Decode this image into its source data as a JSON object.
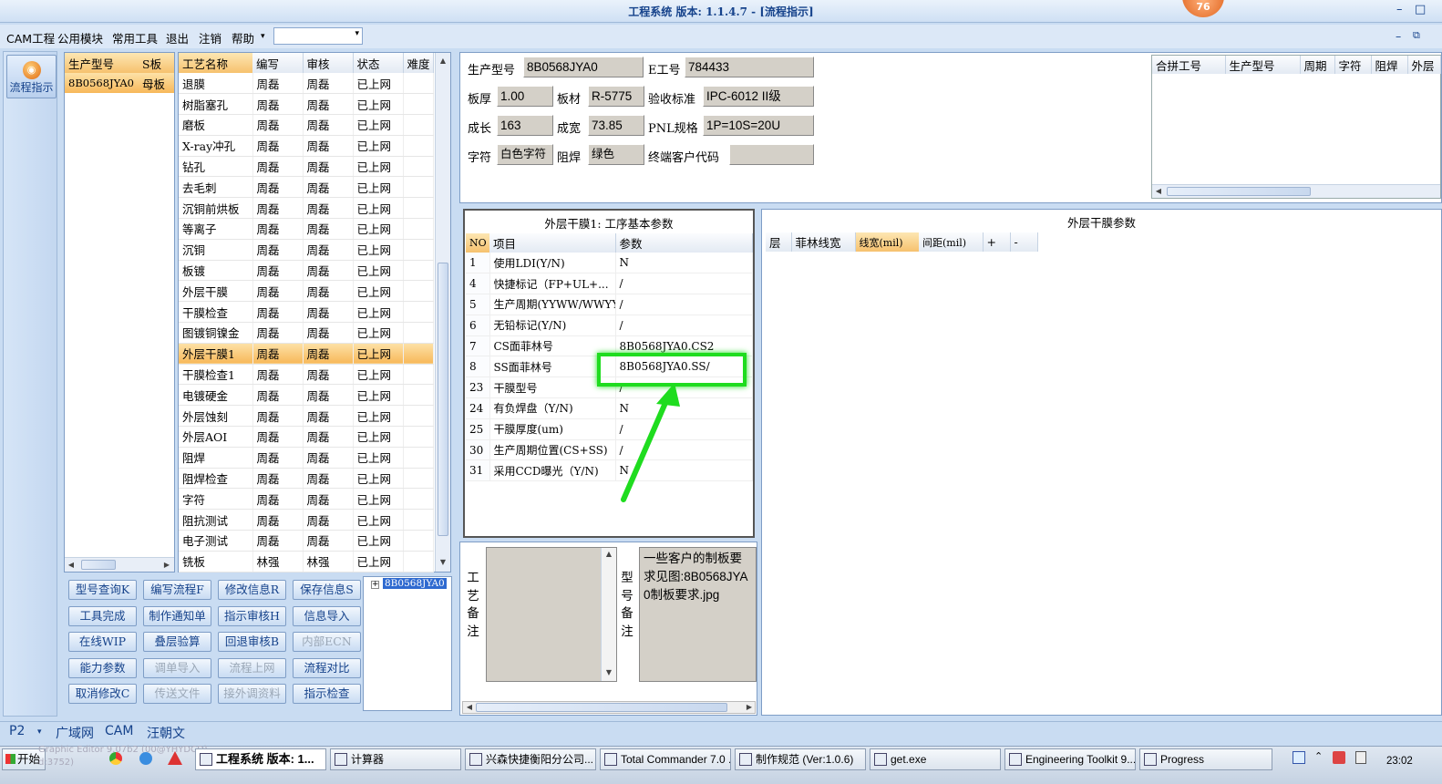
{
  "window": {
    "title": "工程系统   版本: 1.1.4.7 - [流程指示]",
    "badge": "76",
    "min": "–",
    "close": "□",
    "min2": "–",
    "restore": "⧉"
  },
  "menu": {
    "items": [
      "CAM工程",
      "公用模块",
      "常用工具",
      "退出",
      "注销",
      "帮助"
    ],
    "help_arrow": "▾",
    "combo_value": "",
    "combo_arrow": "▾"
  },
  "nav": {
    "button_label": "流程指示",
    "icon": "flow-icon"
  },
  "models": {
    "headers": [
      "生产型号",
      "S板"
    ],
    "rows": [
      [
        "8B0568JYA0",
        "母板"
      ]
    ]
  },
  "process": {
    "headers": [
      "工艺名称",
      "编写",
      "审核",
      "状态",
      "难度"
    ],
    "selected_index": 13,
    "rows": [
      [
        "退膜",
        "周磊",
        "周磊",
        "已上网",
        ""
      ],
      [
        "树脂塞孔",
        "周磊",
        "周磊",
        "已上网",
        ""
      ],
      [
        "磨板",
        "周磊",
        "周磊",
        "已上网",
        ""
      ],
      [
        "X-ray冲孔",
        "周磊",
        "周磊",
        "已上网",
        ""
      ],
      [
        "钻孔",
        "周磊",
        "周磊",
        "已上网",
        ""
      ],
      [
        "去毛刺",
        "周磊",
        "周磊",
        "已上网",
        ""
      ],
      [
        "沉铜前烘板",
        "周磊",
        "周磊",
        "已上网",
        ""
      ],
      [
        "等离子",
        "周磊",
        "周磊",
        "已上网",
        ""
      ],
      [
        "沉铜",
        "周磊",
        "周磊",
        "已上网",
        ""
      ],
      [
        "板镀",
        "周磊",
        "周磊",
        "已上网",
        ""
      ],
      [
        "外层干膜",
        "周磊",
        "周磊",
        "已上网",
        ""
      ],
      [
        "干膜检查",
        "周磊",
        "周磊",
        "已上网",
        ""
      ],
      [
        "图镀铜镍金",
        "周磊",
        "周磊",
        "已上网",
        ""
      ],
      [
        "外层干膜1",
        "周磊",
        "周磊",
        "已上网",
        ""
      ],
      [
        "干膜检查1",
        "周磊",
        "周磊",
        "已上网",
        ""
      ],
      [
        "电镀硬金",
        "周磊",
        "周磊",
        "已上网",
        ""
      ],
      [
        "外层蚀刻",
        "周磊",
        "周磊",
        "已上网",
        ""
      ],
      [
        "外层AOI",
        "周磊",
        "周磊",
        "已上网",
        ""
      ],
      [
        "阻焊",
        "周磊",
        "周磊",
        "已上网",
        ""
      ],
      [
        "阻焊检查",
        "周磊",
        "周磊",
        "已上网",
        ""
      ],
      [
        "字符",
        "周磊",
        "周磊",
        "已上网",
        ""
      ],
      [
        "阻抗测试",
        "周磊",
        "周磊",
        "已上网",
        ""
      ],
      [
        "电子测试",
        "周磊",
        "周磊",
        "已上网",
        ""
      ],
      [
        "铣板",
        "林强",
        "林强",
        "已上网",
        ""
      ]
    ]
  },
  "buttons": [
    [
      "型号查询K",
      "编写流程F",
      "修改信息R",
      "保存信息S"
    ],
    [
      "工具完成",
      "制作通知单",
      "指示审核H",
      "信息导入"
    ],
    [
      "在线WIP",
      "叠层验算",
      "回退审核B",
      "内部ECN"
    ],
    [
      "能力参数",
      "调单导入",
      "流程上网",
      "流程对比"
    ],
    [
      "取消修改C",
      "传送文件",
      "接外调资料",
      "指示检查"
    ]
  ],
  "disabled_buttons": [
    "内部ECN",
    "调单导入",
    "流程上网",
    "传送文件",
    "接外调资料"
  ],
  "tree": {
    "expander": "+",
    "node": "8B0568JYA0"
  },
  "info": {
    "model_label": "生产型号",
    "model_value": "8B0568JYA0",
    "e_label": "E工号",
    "e_value": "784433",
    "thick_label": "板厚",
    "thick_value": "1.00",
    "mat_label": "板材",
    "mat_value": "R-5775",
    "std_label": "验收标准",
    "std_value": "IPC-6012 II级",
    "len_label": "成长",
    "len_value": "163",
    "wid_label": "成宽",
    "wid_value": "73.85",
    "pnl_label": "PNL规格",
    "pnl_value": "1P=10S=20U",
    "char_label": "字符",
    "char_value": "白色字符",
    "mask_label": "阻焊",
    "mask_value": "绿色",
    "cust_label": "终端客户代码",
    "cust_value": ""
  },
  "combined": {
    "headers": [
      "合拼工号",
      "生产型号",
      "周期",
      "字符",
      "阻焊",
      "外层"
    ]
  },
  "params": {
    "title": "外层干膜1: 工序基本参数",
    "headers": [
      "NO",
      "项目",
      "参数"
    ],
    "rows": [
      [
        "1",
        "使用LDI(Y/N)",
        "N"
      ],
      [
        "4",
        "快捷标记（FP+UL+...",
        "/"
      ],
      [
        "5",
        "生产周期(YYWW/WWYY)",
        "/"
      ],
      [
        "6",
        "无铅标记(Y/N)",
        "/"
      ],
      [
        "7",
        "CS面菲林号",
        "8B0568JYA0.CS2"
      ],
      [
        "8",
        "SS面菲林号",
        "8B0568JYA0.SS/"
      ],
      [
        "23",
        "干膜型号",
        "/"
      ],
      [
        "24",
        "有负焊盘（Y/N)",
        "N"
      ],
      [
        "25",
        "干膜厚度(um)",
        "/"
      ],
      [
        "30",
        "生产周期位置(CS+SS)",
        "/"
      ],
      [
        "31",
        "采用CCD曝光（Y/N)",
        "N"
      ]
    ]
  },
  "dryfilm": {
    "title": "外层干膜参数",
    "headers": [
      "层",
      "菲林线宽",
      "线宽(mil)",
      "间距(mil)",
      "+",
      "-"
    ]
  },
  "remarks": {
    "process_label": "工艺备注",
    "process_text": "",
    "model_label": "型号备注",
    "model_text": "一些客户的制板要求见图:8B0568JYA0制板要求.jpg"
  },
  "bottom_tabs": {
    "left": "P2",
    "arrow": "▾",
    "items": [
      "广域网",
      "CAM",
      "汪朝文"
    ]
  },
  "taskbar": {
    "start": "开始",
    "items": [
      "工程系统   版本: 1...",
      "计算器",
      "兴森快捷衡阳分公司...",
      "Total Commander 7.0 ...",
      "制作规范 (Ver:1.0.6)",
      "get.exe",
      "Engineering Toolkit 9....",
      "Progress"
    ],
    "clock": "23:02",
    "ghost": "Graphic Editor 9.07b2 (00@YHYDCD)",
    "ghost2": "d:3752)"
  },
  "colors": {
    "accent": "#15428b",
    "highlight_box": "#1fdc1f",
    "selected_row": "#f7b85a"
  }
}
